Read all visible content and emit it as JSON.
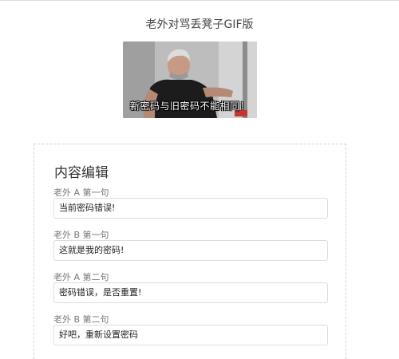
{
  "page": {
    "title": "老外对骂丢凳子GIF版"
  },
  "preview": {
    "caption": "新密码与旧密码不能相同！"
  },
  "editor": {
    "heading": "内容编辑",
    "fields": [
      {
        "label": "老外 A 第一句",
        "value": "当前密码错误!"
      },
      {
        "label": "老外 B 第一句",
        "value": "这就是我的密码!"
      },
      {
        "label": "老外 A 第二句",
        "value": "密码错误，是否重置!"
      },
      {
        "label": "老外 B 第二句",
        "value": "好吧，重新设置密码"
      }
    ]
  }
}
